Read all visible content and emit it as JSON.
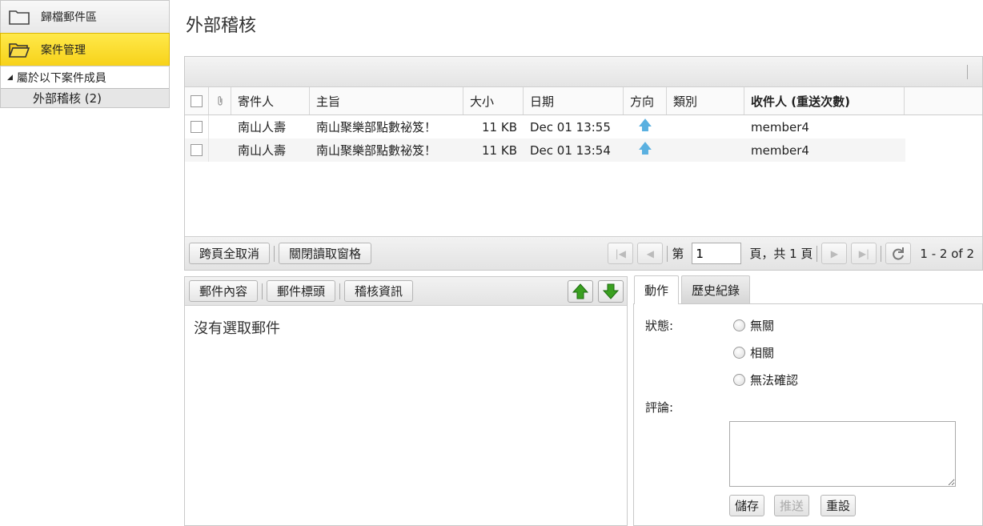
{
  "sidebar": {
    "items": [
      {
        "label": "歸檔郵件區"
      },
      {
        "label": "案件管理"
      }
    ],
    "tree_header": "屬於以下案件成員",
    "tree_child": "外部稽核 (2)"
  },
  "page_title": "外部稽核",
  "grid": {
    "columns": [
      "寄件人",
      "主旨",
      "大小",
      "日期",
      "方向",
      "類別",
      "收件人 (重送次數)"
    ],
    "rows": [
      {
        "from": "南山人壽",
        "subject": "南山聚樂部點數祕笈！",
        "size": "11 KB",
        "date": "Dec 01 13:55",
        "direction": "up-arrow",
        "category": "",
        "to": "member4"
      },
      {
        "from": "南山人壽",
        "subject": "南山聚樂部點數祕笈！",
        "size": "11 KB",
        "date": "Dec 01 13:54",
        "direction": "up-arrow",
        "category": "",
        "to": "member4"
      }
    ],
    "footer": {
      "deselect_all": "跨頁全取消",
      "close_reading_pane": "關閉讀取窗格",
      "page_label": "第",
      "page_value": "1",
      "page_total": "頁，共 1 頁",
      "range": "1 - 2 of 2"
    }
  },
  "preview": {
    "tabs": [
      "郵件內容",
      "郵件標頭",
      "稽核資訊"
    ],
    "empty_message": "沒有選取郵件"
  },
  "action": {
    "tabs": [
      "動作",
      "歷史紀錄"
    ],
    "status_label": "狀態:",
    "options": [
      "無關",
      "相關",
      "無法確認"
    ],
    "comment_label": "評論:",
    "buttons": {
      "save": "儲存",
      "push": "推送",
      "reset": "重設"
    }
  },
  "colors": {
    "active_nav": "#f7d21a",
    "arrow_up": "#5ab0e0",
    "green_button": "#3aa020"
  }
}
